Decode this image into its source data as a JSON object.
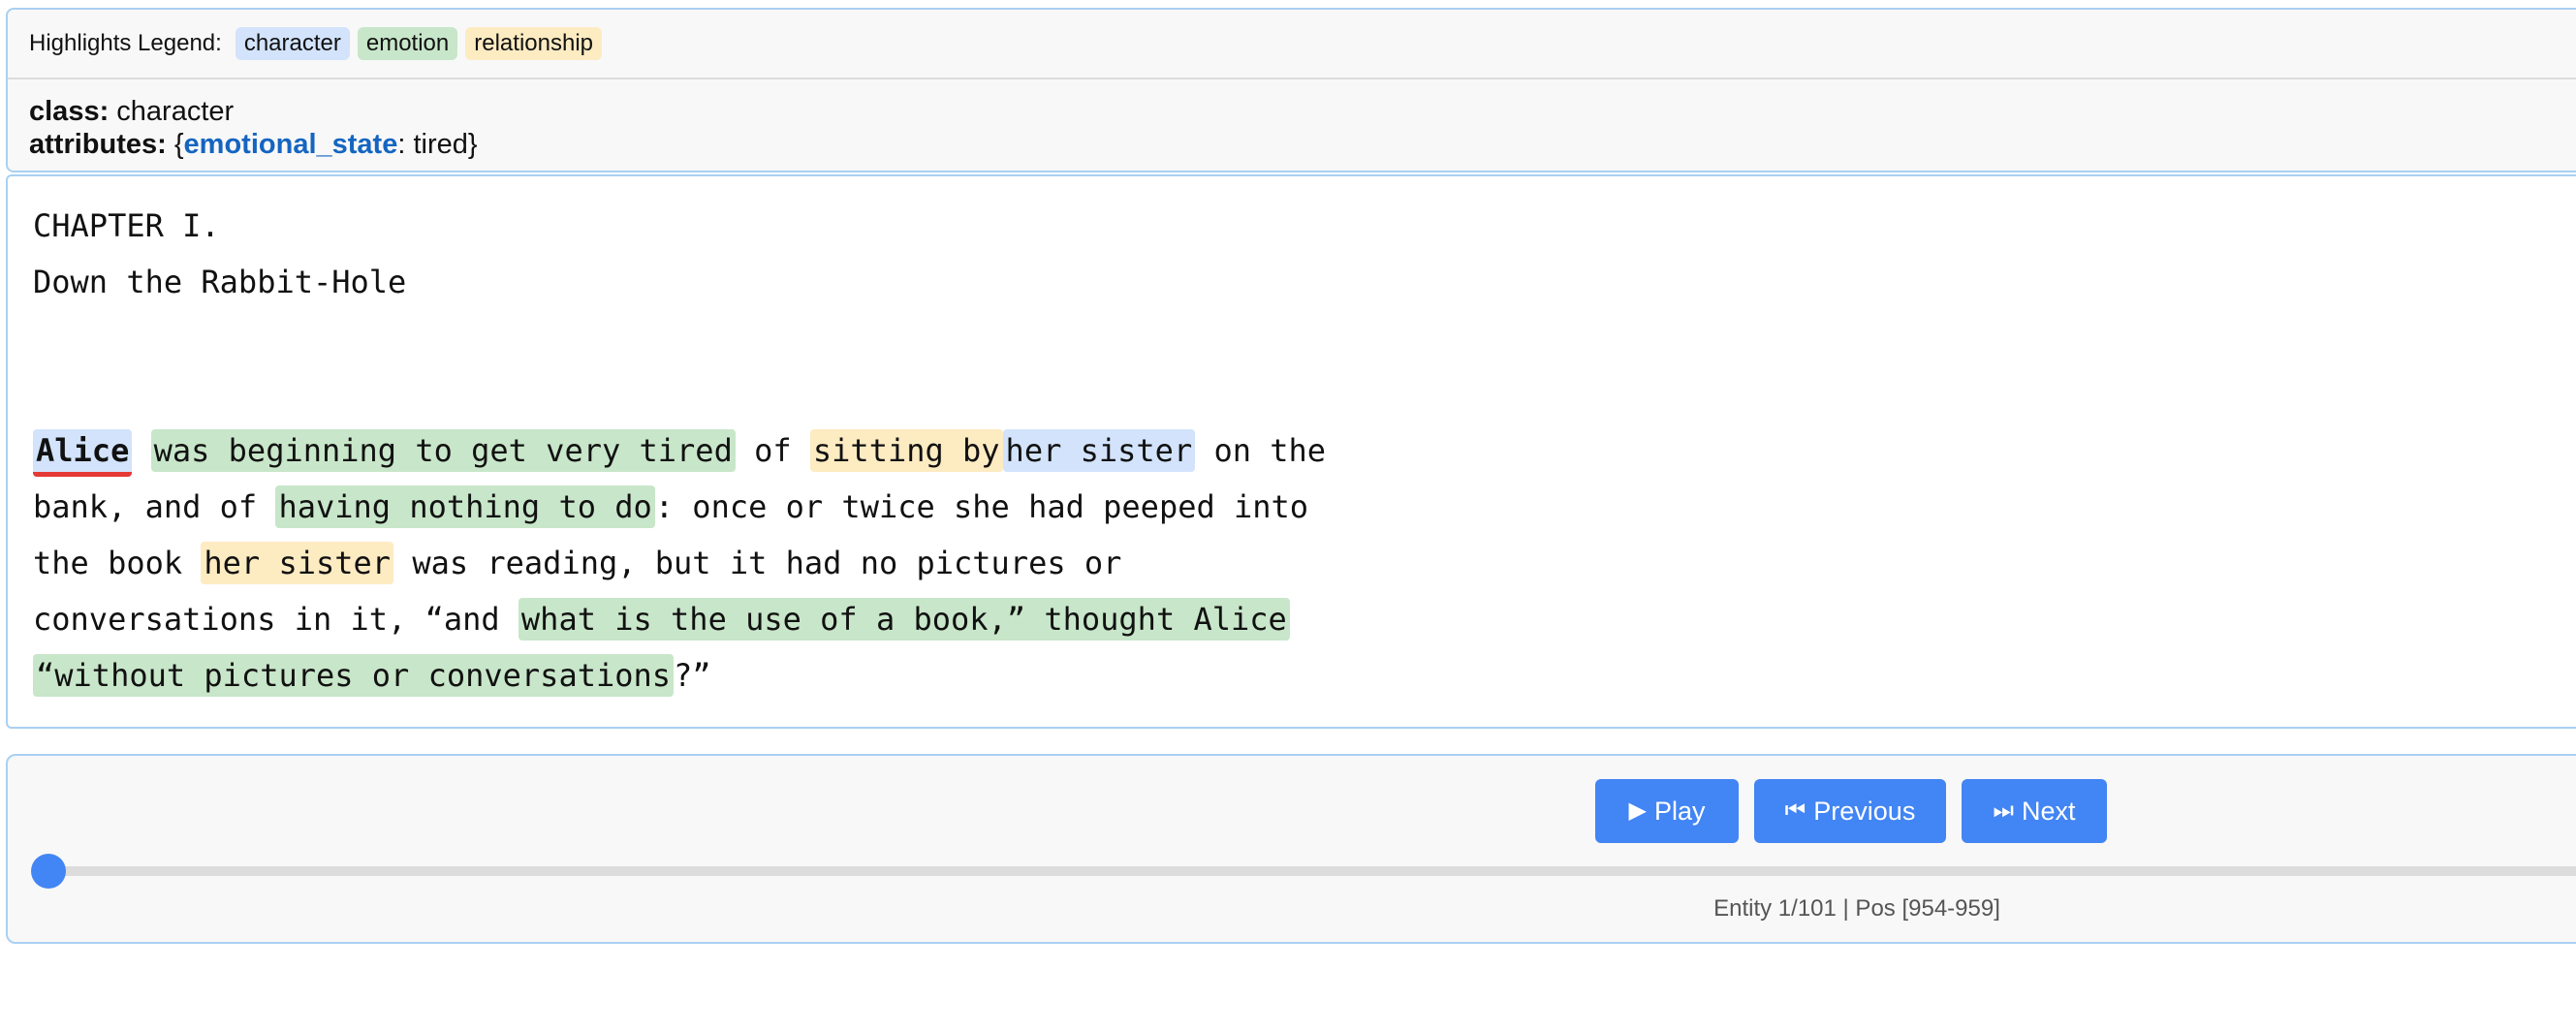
{
  "legend": {
    "title": "Highlights Legend:",
    "items": [
      {
        "label": "character",
        "color": "#d2e3fb"
      },
      {
        "label": "emotion",
        "color": "#c8e6c9"
      },
      {
        "label": "relationship",
        "color": "#fdebc2"
      }
    ]
  },
  "details": {
    "class_key": "class:",
    "class_value": "character",
    "attributes_key": "attributes:",
    "attr_open": "{",
    "attr_name": "emotional_state",
    "attr_sep": ":",
    "attr_value": "tired",
    "attr_close": "}"
  },
  "text": {
    "heading1": "CHAPTER I.",
    "heading2": "Down the Rabbit-Hole",
    "line1": {
      "alice": "Alice",
      "emo1": "was beginning to get very tired",
      "of": " of ",
      "rel1": "sitting by",
      "char1": "her sister",
      "tail": " on the"
    },
    "line2": {
      "pre": "bank, and of ",
      "emo2": "having nothing to do",
      "tail": ": once or twice she had peeped into"
    },
    "line3": {
      "pre": "the book ",
      "rel2": "her sister",
      "tail": " was reading, but it had no pictures or"
    },
    "line4": {
      "pre": "conversations in it, “and ",
      "emo3": "what is the use of a book,” thought Alice"
    },
    "line5": {
      "emo4": "“without pictures or conversations",
      "tail": "?”"
    }
  },
  "controls": {
    "play_label": "Play",
    "play_icon": "▶",
    "prev_label": "Previous",
    "prev_icon": "⏮",
    "next_label": "Next",
    "next_icon": "⏭",
    "slider_progress": 0.0,
    "status": "Entity 1/101 | Pos [954-959]"
  },
  "colors": {
    "accent": "#4285f4",
    "active_underline": "#e53935",
    "attr_key": "#1565c0",
    "panel_border": "#a9d0f2"
  }
}
